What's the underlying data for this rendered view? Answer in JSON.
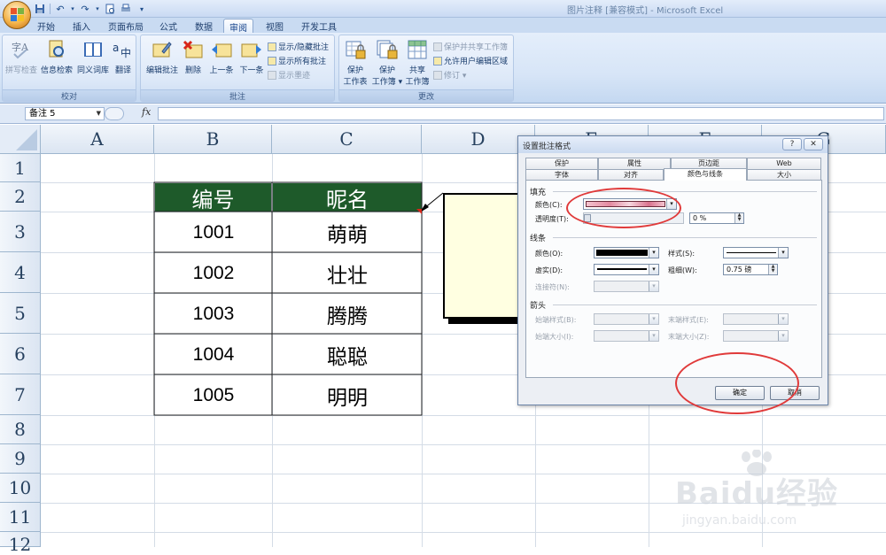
{
  "window": {
    "title": "图片注释 [兼容模式] - Microsoft Excel"
  },
  "qat": {
    "icons": [
      "save-icon",
      "undo-icon",
      "redo-icon",
      "print-preview-icon",
      "customize-icon"
    ]
  },
  "ribbon": {
    "tabs": [
      "开始",
      "插入",
      "页面布局",
      "公式",
      "数据",
      "审阅",
      "视图",
      "开发工具"
    ],
    "active_tab": "审阅",
    "groups": {
      "proofing": {
        "label": "校对",
        "buttons": [
          "拼写检查",
          "信息检索",
          "同义词库",
          "翻译"
        ]
      },
      "comments": {
        "label": "批注",
        "buttons": [
          "编辑批注",
          "删除",
          "上一条",
          "下一条"
        ],
        "small": [
          "显示/隐藏批注",
          "显示所有批注",
          "显示墨迹"
        ]
      },
      "changes": {
        "label": "更改",
        "buttons": [
          {
            "l1": "保护",
            "l2": "工作表"
          },
          {
            "l1": "保护",
            "l2": "工作簿 ▾"
          },
          {
            "l1": "共享",
            "l2": "工作簿"
          }
        ],
        "small": [
          "保护并共享工作簿",
          "允许用户编辑区域",
          "修订 ▾"
        ]
      }
    }
  },
  "formula_bar": {
    "name_box": "备注 5",
    "fx": "fx",
    "value": ""
  },
  "grid": {
    "columns": [
      "A",
      "B",
      "C",
      "D",
      "E",
      "F",
      "G"
    ],
    "rows": [
      "1",
      "2",
      "3",
      "4",
      "5",
      "6",
      "7",
      "8",
      "9",
      "10",
      "11",
      "12"
    ],
    "table": {
      "headers": [
        "编号",
        "昵名"
      ],
      "rows": [
        [
          "1001",
          "萌萌"
        ],
        [
          "1002",
          "壮壮"
        ],
        [
          "1003",
          "腾腾"
        ],
        [
          "1004",
          "聪聪"
        ],
        [
          "1005",
          "明明"
        ]
      ],
      "header_color": "#1e5a2a"
    }
  },
  "dialog": {
    "title": "设置批注格式",
    "help": "?",
    "tabs_row1": [
      "保护",
      "属性",
      "页边距",
      "Web"
    ],
    "tabs_row2": [
      "字体",
      "对齐",
      "颜色与线条",
      "大小"
    ],
    "active_tab": "颜色与线条",
    "fill": {
      "section": "填充",
      "color_label": "颜色(C):",
      "transparency_label": "透明度(T):",
      "transparency_value": "0 %"
    },
    "line": {
      "section": "线条",
      "color_label": "颜色(O):",
      "style_label": "样式(S):",
      "dash_label": "虚实(D):",
      "weight_label": "粗细(W):",
      "weight_value": "0.75 磅",
      "connector_label": "连接符(N):"
    },
    "arrows": {
      "section": "箭头",
      "begin_style": "始端样式(B):",
      "end_style": "末端样式(E):",
      "begin_size": "始端大小(I):",
      "end_size": "末端大小(Z):"
    },
    "ok": "确定",
    "cancel": "取消"
  },
  "watermark": {
    "text": "Baidu经验",
    "url": "jingyan.baidu.com"
  },
  "colors": {
    "annotation_red": "#e03a3a",
    "header_green": "#1e5a2a",
    "comment_fill": "#ffffe1"
  }
}
